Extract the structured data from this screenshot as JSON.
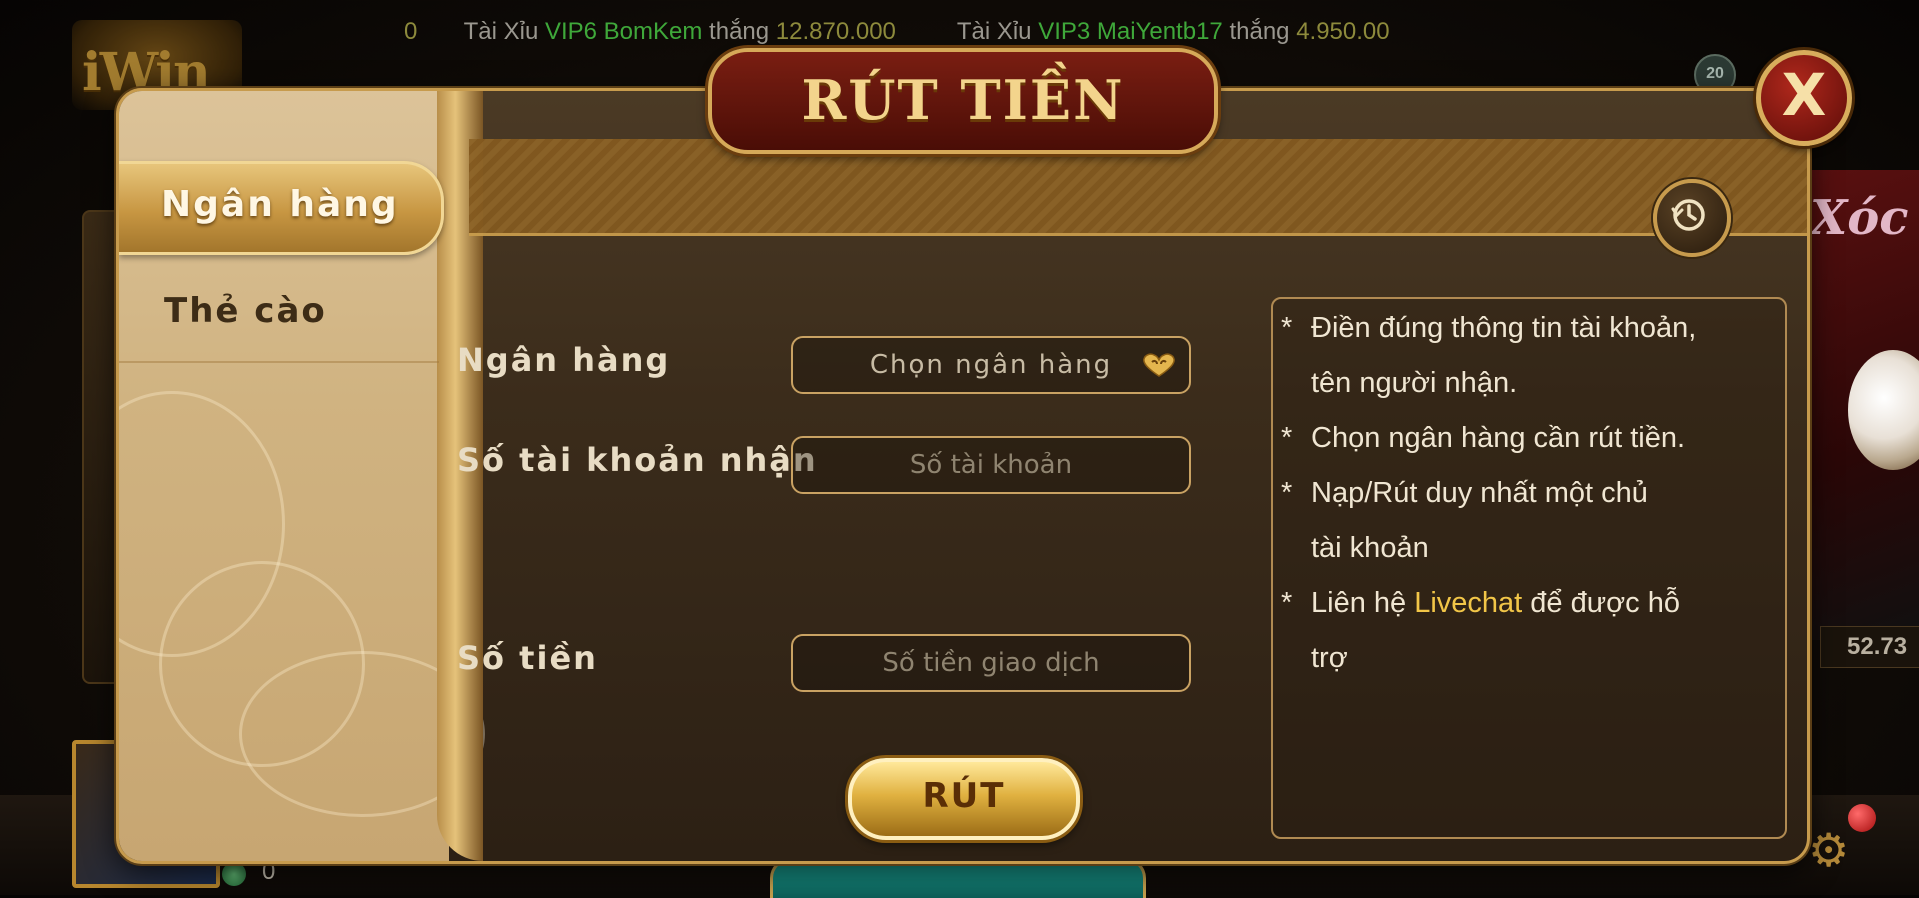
{
  "ticker": {
    "lead_value": "0",
    "items": [
      {
        "game": "Tài Xỉu",
        "player": "VIP6 BomKem",
        "verb": "thắng",
        "amount": "12.870.000"
      },
      {
        "game": "Tài Xỉu",
        "player": "VIP3 MaiYentb17",
        "verb": "thắng",
        "amount": "4.950.00"
      }
    ]
  },
  "background": {
    "room_badge": "20",
    "right_value": "52.73",
    "balance": "0"
  },
  "dialog": {
    "title": "RÚT TIỀN",
    "close_label": "X",
    "tabs": [
      {
        "label": "Ngân hàng",
        "active": true
      },
      {
        "label": "Thẻ cào",
        "active": false
      }
    ],
    "history_icon": "history-clock-icon",
    "form": {
      "bank_label": "Ngân hàng",
      "bank_placeholder": "Chọn ngân hàng",
      "account_label": "Số tài khoản nhận",
      "account_placeholder": "Số tài khoản",
      "amount_label": "Số tiền",
      "amount_placeholder": "Số tiền giao dịch",
      "submit_label": "RÚT"
    },
    "notes": {
      "bullet": "*",
      "n1_line1": "Điền đúng thông tin tài khoản,",
      "n1_line2": "tên người nhận.",
      "n2": "Chọn ngân hàng cần rút tiền.",
      "n3_line1": "Nạp/Rút duy nhất một chủ",
      "n3_line2": "tài khoản",
      "n4_pre": "Liên hệ ",
      "n4_link": "Livechat",
      "n4_post": " để được hỗ",
      "n4_line2": "trợ"
    }
  },
  "colors": {
    "accent_gold": "#c79b4d",
    "title_red": "#7a1e12",
    "link_yellow": "#f2c648",
    "ticker_green": "#3fa83a"
  }
}
